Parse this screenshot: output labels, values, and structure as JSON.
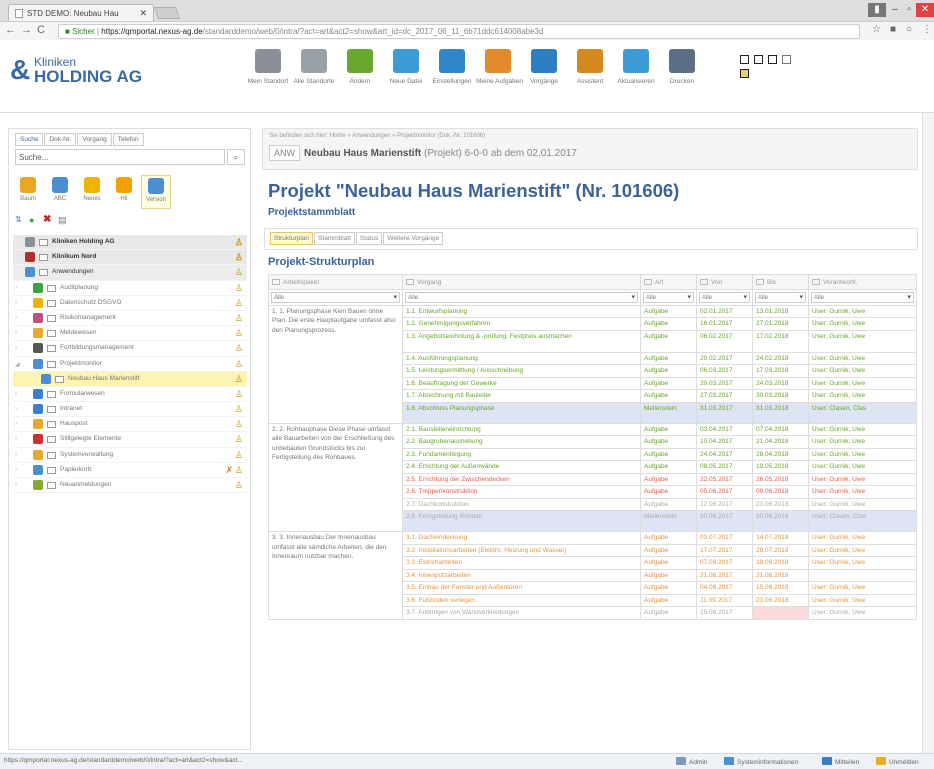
{
  "browser": {
    "tab_title": "STD DEMO: Neubau Hau",
    "security_label": "Sicher",
    "url_domain": "https://qmportal.nexus-ag.de",
    "url_path": "/standarddemo/web/0/intra/?act=art&act2=show&art_id=dc_2017_06_11_6b71ddc614008abe3d"
  },
  "logo": {
    "line1": "Kliniken",
    "line2": "HOLDING AG"
  },
  "toolbar": [
    {
      "label": "Mein Standort",
      "icon": "building-icon",
      "color": "#8a8f99"
    },
    {
      "label": "Alle Standorte",
      "icon": "buildings-icon",
      "color": "#9aa0a8"
    },
    {
      "label": "Ändern",
      "icon": "pencil-icon",
      "color": "#69a82e"
    },
    {
      "label": "Neue Datei",
      "icon": "new-document-icon",
      "color": "#3b9bd6"
    },
    {
      "label": "Einstellungen",
      "icon": "binders-icon",
      "color": "#2f86c9"
    },
    {
      "label": "Meine Aufgaben",
      "icon": "tasks-icon",
      "color": "#e58a2c"
    },
    {
      "label": "Vorgänge",
      "icon": "processes-icon",
      "color": "#2c7fc2"
    },
    {
      "label": "Assistent",
      "icon": "assistant-icon",
      "color": "#d48a1f"
    },
    {
      "label": "Aktualisieren",
      "icon": "refresh-icon",
      "color": "#3b9bd6"
    },
    {
      "label": "Drucken",
      "icon": "printer-icon",
      "color": "#5a6f86"
    }
  ],
  "left": {
    "search_tabs": [
      "Suche",
      "Dok-Nr.",
      "Vorgang",
      "Telefon"
    ],
    "search_placeholder": "Suche...",
    "view_buttons": [
      {
        "label": "Baum",
        "icon": "tree-icon",
        "color": "#e8a81f"
      },
      {
        "label": "ABC",
        "icon": "abc-icon",
        "color": "#4a90d0"
      },
      {
        "label": "Neues",
        "icon": "new-icon",
        "color": "#f0b400"
      },
      {
        "label": "Hit",
        "icon": "star-icon",
        "color": "#f3a100"
      },
      {
        "label": "Version",
        "icon": "clock-icon",
        "color": "#4a90d0"
      }
    ],
    "tree": [
      {
        "label": "Kliniken Holding AG",
        "indent": 0,
        "style": "dark",
        "icon_color": "#8a9099"
      },
      {
        "label": "Klinikum Nord",
        "indent": 0,
        "style": "dark",
        "icon_color": "#b03030"
      },
      {
        "label": "Anwendungen",
        "indent": 0,
        "style": "dark2",
        "icon_color": "#4a90d0"
      },
      {
        "label": "Auditplanung",
        "indent": 1,
        "style": "",
        "icon_color": "#3aa240"
      },
      {
        "label": "Datenschutz DSGVO",
        "indent": 1,
        "style": "",
        "icon_color": "#f0b400"
      },
      {
        "label": "Risikomanagement",
        "indent": 1,
        "style": "",
        "icon_color": "#c05080"
      },
      {
        "label": "Meldewesen",
        "indent": 1,
        "style": "",
        "icon_color": "#e8a830"
      },
      {
        "label": "Fortbildungsmanagement",
        "indent": 1,
        "style": "",
        "icon_color": "#555555"
      },
      {
        "label": "Projektmonitor",
        "indent": 1,
        "style": "",
        "icon_color": "#4a90d0",
        "open": true
      },
      {
        "label": "Neubau Haus Marienstift",
        "indent": 2,
        "style": "sel",
        "icon_color": "#4a90d0"
      },
      {
        "label": "Formularwesen",
        "indent": 1,
        "style": "",
        "icon_color": "#3b7fd0"
      },
      {
        "label": "Intranet",
        "indent": 1,
        "style": "",
        "icon_color": "#3b7fd0"
      },
      {
        "label": "Hauspost",
        "indent": 1,
        "style": "",
        "icon_color": "#e8a830"
      },
      {
        "label": "Stillgelegte Elemente",
        "indent": 1,
        "style": "",
        "icon_color": "#d03030"
      },
      {
        "label": "Systemverwaltung",
        "indent": 1,
        "style": "",
        "icon_color": "#e8a830"
      },
      {
        "label": "Papierkorb",
        "indent": 1,
        "style": "",
        "icon_color": "#4a90d0"
      },
      {
        "label": "Neuanmeldungen",
        "indent": 1,
        "style": "",
        "icon_color": "#88aa33"
      }
    ]
  },
  "main": {
    "breadcrumb": "Sie befinden sich hier: Home » Anwendungen » Projektmonitor (Dok.-Nr. 101606)",
    "header_badge": "ANW",
    "header_name": "Neubau Haus Marienstift",
    "header_rest": "(Projekt)  6-0-0 ab dem 02.01.2017",
    "title": "Projekt \"Neubau Haus Marienstift\" (Nr. 101606)",
    "subtitle": "Projektstammblatt",
    "tabs": [
      "Strukturplan",
      "Stammblatt",
      "Status",
      "Weitere Vorgänge"
    ],
    "section_title": "Projekt-Strukturplan",
    "columns": [
      "Arbeitspaket",
      "Vorgang",
      "Art",
      "Von",
      "Bis",
      "Verantwortl."
    ],
    "filter_value": "Alle",
    "groups": [
      {
        "package": "1. 1. Planungsphase Kein Bauen ohne Plan. Die erste Hauptaufgabe umfasst also den Planungsprozess.",
        "rows": [
          {
            "task": "1.1. Entwurfsplanung",
            "type": "Aufgabe",
            "from": "02.01.2017",
            "to": "13.01.2018",
            "resp": "User: Gurnik, Uwe",
            "color": "g"
          },
          {
            "task": "1.2. Genehmigungsverfahren",
            "type": "Aufgabe",
            "from": "16.01.2017",
            "to": "27.01.2018",
            "resp": "User: Gurnik, Uwe",
            "color": "g"
          },
          {
            "task": "1.3. Angebotseinholung & -prüfung: Festpreis ausmachen",
            "type": "Aufgabe",
            "from": "06.02.2017",
            "to": "17.02.2018",
            "resp": "User: Gurnik, Uwe",
            "color": "g",
            "tall": true
          },
          {
            "task": "1.4. Ausführungsplanung",
            "type": "Aufgabe",
            "from": "20.02.2017",
            "to": "24.02.2018",
            "resp": "User: Gurnik, Uwe",
            "color": "g"
          },
          {
            "task": "1.5. Leistungsermittlung / Ausschreibung",
            "type": "Aufgabe",
            "from": "06.03.2017",
            "to": "17.03.2018",
            "resp": "User: Gurnik, Uwe",
            "color": "g"
          },
          {
            "task": "1.6. Beauftragung der Gewerke",
            "type": "Aufgabe",
            "from": "20.03.2017",
            "to": "24.03.2018",
            "resp": "User: Gurnik, Uwe",
            "color": "g"
          },
          {
            "task": "1.7. Abrechnung mit Bauleiter",
            "type": "Aufgabe",
            "from": "27.03.2017",
            "to": "30.03.2018",
            "resp": "User: Gurnik, Uwe",
            "color": "g"
          },
          {
            "task": "1.8. Abschluss Planungsphase",
            "type": "Meilenstein",
            "from": "31.03.2017",
            "to": "31.03.2018",
            "resp": "User: Clasen, Clas",
            "color": "g",
            "milestone": true
          }
        ]
      },
      {
        "package": "2. 2. Rohbauphase Diese Phase umfasst alle Bauarbeiten von der Erschließung des unbebauten Grundstücks bis zur Fertigstellung des Rohbaues.",
        "rows": [
          {
            "task": "2.1. Baustelleneinrichtung",
            "type": "Aufgabe",
            "from": "03.04.2017",
            "to": "07.04.2018",
            "resp": "User: Gurnik, Uwe",
            "color": "g"
          },
          {
            "task": "2.2. Baugrubenaushebung",
            "type": "Aufgabe",
            "from": "10.04.2017",
            "to": "21.04.2018",
            "resp": "User: Gurnik, Uwe",
            "color": "g"
          },
          {
            "task": "2.3. Fundamentlegung",
            "type": "Aufgabe",
            "from": "24.04.2017",
            "to": "28.04.2018",
            "resp": "User: Gurnik, Uwe",
            "color": "g"
          },
          {
            "task": "2.4. Errichtung der Außenwände",
            "type": "Aufgabe",
            "from": "08.05.2017",
            "to": "19.05.2018",
            "resp": "User: Gurnik, Uwe",
            "color": "g"
          },
          {
            "task": "2.5. Errichtung der Zwischendecken",
            "type": "Aufgabe",
            "from": "22.05.2017",
            "to": "26.05.2018",
            "resp": "User: Gurnik, Uwe",
            "color": "rd"
          },
          {
            "task": "2.6. Treppenkonstruktion",
            "type": "Aufgabe",
            "from": "05.06.2017",
            "to": "09.06.2018",
            "resp": "User: Gurnik, Uwe",
            "color": "rd"
          },
          {
            "task": "2.7. Dachkonstruktion",
            "type": "Aufgabe",
            "from": "12.06.2017",
            "to": "23.06.2018",
            "resp": "User: Gurnik, Uwe",
            "color": "gr"
          },
          {
            "task": "2.8. Fertigstellung Rohbau",
            "type": "Meilenstein",
            "from": "30.06.2017",
            "to": "30.06.2018",
            "resp": "User: Clasen, Clas",
            "color": "gr",
            "milestone": true
          }
        ]
      },
      {
        "package": "3. 3. Innenausbau Der Innenausbau umfasst alle sämtliche Arbeiten, die den Innenraum nutzbar machen.",
        "rows": [
          {
            "task": "3.1. Dacheindeckung",
            "type": "Aufgabe",
            "from": "03.07.2017",
            "to": "14.07.2018",
            "resp": "User: Gurnik, Uwe",
            "color": "or"
          },
          {
            "task": "3.2. Installationsarbeiten (Elektro, Heizung und Wasser)",
            "type": "Aufgabe",
            "from": "17.07.2017",
            "to": "28.07.2018",
            "resp": "User: Gurnik, Uwe",
            "color": "or"
          },
          {
            "task": "3.3. Estricharbeiten",
            "type": "Aufgabe",
            "from": "07.08.2017",
            "to": "18.08.2018",
            "resp": "User: Gurnik, Uwe",
            "color": "or"
          },
          {
            "task": "3.4. Innenputzarbeiten",
            "type": "Aufgabe",
            "from": "21.08.2017",
            "to": "31.08.2018",
            "resp": "",
            "color": "or"
          },
          {
            "task": "3.5. Einbau der Fenster und Außentüren",
            "type": "Aufgabe",
            "from": "04.09.2017",
            "to": "15.09.2018",
            "resp": "User: Gurnik, Uwe",
            "color": "or"
          },
          {
            "task": "3.6. Fußboden verlegen",
            "type": "Aufgabe",
            "from": "11.09.2017",
            "to": "23.06.2018",
            "resp": "User: Gurnik, Uwe",
            "color": "or"
          },
          {
            "task": "3.7. Anbringen von Wandverkleidungen",
            "type": "Aufgabe",
            "from": "25.09.2017",
            "to": "",
            "resp": "User: Gurnik, Uwe",
            "color": "gr",
            "pink_to": true
          }
        ]
      }
    ]
  },
  "status": {
    "url": "https://qmportal.nexus-ag.de/standarddemo/web/0/intra/?act=art&act2=show&act...",
    "items": [
      "Admin",
      "Systeminformationen",
      "Mitteilen",
      "Unmelden"
    ]
  },
  "colors": {
    "accent": "#3b6398",
    "green": "#6aa52a",
    "red": "#e06050",
    "orange": "#e3953e",
    "milestone_bg": "#dde4f3"
  }
}
